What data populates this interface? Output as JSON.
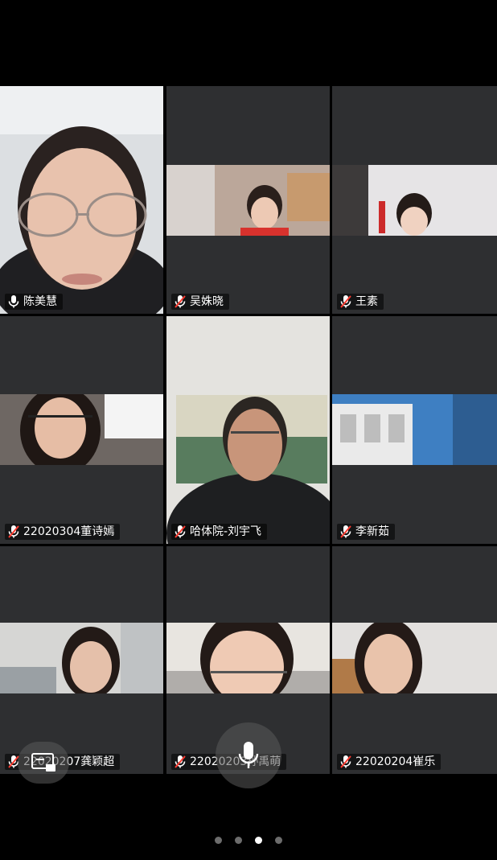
{
  "participants": [
    {
      "name": "陈美慧",
      "muted": false
    },
    {
      "name": "吴姝晓",
      "muted": true
    },
    {
      "name": "王素",
      "muted": true
    },
    {
      "name": "22020304董诗嫣",
      "muted": true
    },
    {
      "name": "哈体院-刘宇飞",
      "muted": true
    },
    {
      "name": "李新茹",
      "muted": true
    },
    {
      "name": "22020207龚颖超",
      "muted": true
    },
    {
      "name": "22020203孙禹萌",
      "muted": true
    },
    {
      "name": "22020204崔乐",
      "muted": true
    }
  ],
  "pagination": {
    "total": 4,
    "active_index": 2
  },
  "controls": {
    "screen_share_icon": "screen-share-icon",
    "mic_icon": "microphone-icon"
  },
  "colors": {
    "tile_bg": "#2e2f31",
    "page_bg": "#000000",
    "mute_red": "#ff3b30"
  }
}
